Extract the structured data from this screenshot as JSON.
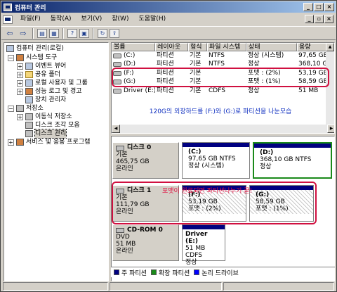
{
  "window": {
    "title": "컴퓨터 관리",
    "btn_min": "_",
    "btn_max": "□",
    "btn_close": "×"
  },
  "menu": [
    {
      "label": "파일(F)"
    },
    {
      "label": "동작(A)"
    },
    {
      "label": "보기(V)"
    },
    {
      "label": "창(W)"
    },
    {
      "label": "도움말(H)"
    }
  ],
  "mdi_buttons": {
    "min": "_",
    "restore": "▫",
    "close": "×"
  },
  "toolbar": {
    "back": "⇦",
    "forward": "⇨",
    "up": "▤",
    "show_tree": "▦",
    "help": "?",
    "props": "▣",
    "refresh": "↻",
    "export": "⇪"
  },
  "tree": {
    "root": "컴퓨터 관리(로컬)",
    "system_tools": "시스템 도구",
    "event_viewer": "이벤트 뷰어",
    "shared_folders": "공유 폴더",
    "local_users": "로컬 사용자 및 그룹",
    "perf_logs": "성능 로그 및 경고",
    "device_manager": "장치 관리자",
    "storage": "저장소",
    "removable": "이동식 저장소",
    "defrag": "디스크 조각 모음",
    "disk_mgmt": "디스크 관리",
    "services": "서비스 및 응용 프로그램"
  },
  "volumes": {
    "headers": {
      "name": "볼륨",
      "layout": "레이아웃",
      "type": "형식",
      "fs": "파일 시스템",
      "status": "상태",
      "capacity": "용량"
    },
    "rows": [
      {
        "name": "(C:)",
        "layout": "파티션",
        "type": "기본",
        "fs": "NTFS",
        "status": "정상 (시스템)",
        "capacity": "97,65 GB"
      },
      {
        "name": "(D:)",
        "layout": "파티션",
        "type": "기본",
        "fs": "NTFS",
        "status": "정상",
        "capacity": "368,10 GB"
      },
      {
        "name": "(F:)",
        "layout": "파티션",
        "type": "기본",
        "fs": "",
        "status": "포맷 : (2%)",
        "capacity": "53,19 GB"
      },
      {
        "name": "(G:)",
        "layout": "파티션",
        "type": "기본",
        "fs": "",
        "status": "포맷 : (1%)",
        "capacity": "58,59 GB"
      },
      {
        "name": "Driver (E:)",
        "layout": "파티션",
        "type": "기본",
        "fs": "CDFS",
        "status": "정상",
        "capacity": "51 MB"
      }
    ],
    "caption": "120G의 외장하드를 (F:)와 (G:)로 파티션을 나눈모습"
  },
  "disks": [
    {
      "name": "디스크 0",
      "kind": "기본",
      "size": "465,75 GB",
      "state": "온라인",
      "parts": [
        {
          "name": "(C:)",
          "line1": "97,65 GB NTFS",
          "line2": "정상 (시스템)"
        },
        {
          "name": "(D:)",
          "line1": "368,10 GB NTFS",
          "line2": "정상"
        }
      ]
    },
    {
      "name": "디스크 1",
      "kind": "기본",
      "size": "111,79 GB",
      "state": "온라인",
      "parts": [
        {
          "name": "(F:)",
          "line1": "53,19 GB",
          "line2": "포맷 : (2%)"
        },
        {
          "name": "(G:)",
          "line1": "58,59 GB",
          "line2": "포맷 : (1%)"
        }
      ]
    },
    {
      "name": "CD-ROM 0",
      "kind": "DVD",
      "size": "51 MB",
      "state": "온라인",
      "parts": [
        {
          "name": "Driver (E:)",
          "line1": "51 MB CDFS",
          "line2": "정상"
        }
      ]
    }
  ],
  "annotation": "포맷이 완료되면 파티션나누기 끝!",
  "legend": [
    {
      "label": "주 파티션",
      "color": "#000080"
    },
    {
      "label": "확장 파티션",
      "color": "#1a8a1a"
    },
    {
      "label": "논리 드라이브",
      "color": "#0000ff"
    }
  ]
}
